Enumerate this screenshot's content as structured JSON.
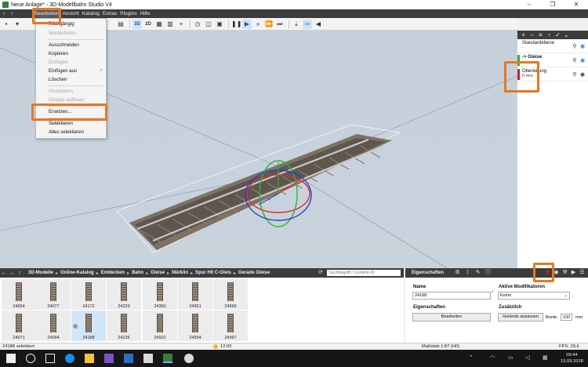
{
  "window": {
    "title": "Neue Anlage* - 3D-Modellbahn Studio V4",
    "title_visible": "Neue Anlage* - 3D-Modellbahn Studio V4"
  },
  "menubar": {
    "items": [
      "Bearbeiten",
      "Ansicht",
      "Katalog",
      "Extras",
      "Plugins",
      "Hilfe"
    ],
    "active": "Bearbeiten"
  },
  "toolbar": {
    "btn_3d": "3D",
    "btn_2d": "2D"
  },
  "dropdown": {
    "items": [
      {
        "label": "Rückgängig",
        "enabled": true
      },
      {
        "label": "Wiederholen",
        "enabled": false
      },
      {
        "label": "Ausschneiden",
        "enabled": true
      },
      {
        "label": "Kopieren",
        "enabled": true
      },
      {
        "label": "Einfügen",
        "enabled": false
      },
      {
        "label": "Einfügen aus",
        "enabled": true,
        "submenu": true
      },
      {
        "label": "Löschen",
        "enabled": true
      },
      {
        "label": "Gruppieren",
        "enabled": false
      },
      {
        "label": "Gruppe auflösen",
        "enabled": false
      },
      {
        "label": "Ersetzen...",
        "enabled": true
      },
      {
        "label": "Selektieren",
        "enabled": true
      },
      {
        "label": "Alles selektieren",
        "enabled": true
      }
    ]
  },
  "layers": [
    {
      "name": "Standardebene",
      "sub": "-",
      "color": "#ffffff"
    },
    {
      "name": "-> Gleise",
      "sub": "-",
      "color": "#2bb52b"
    },
    {
      "name": "Oberleitung",
      "sub": "0 mm",
      "color": "#d21f1f"
    }
  ],
  "catalog": {
    "breadcrumb": [
      "3D-Modelle",
      "Online-Katalog",
      "Entdecken",
      "Bahn",
      "Gleise",
      "Märklin",
      "Spur H0 C-Gleis",
      "Gerade Gleise"
    ],
    "search_placeholder": "Suchbegriff / Content-ID",
    "tiles": [
      "24064",
      "24077",
      "24172",
      "24229",
      "24360",
      "24951",
      "24995",
      "24071",
      "24094",
      "24188",
      "24236",
      "24922",
      "24994",
      "24997"
    ],
    "selected": "24188"
  },
  "properties": {
    "title": "Eigenschaften",
    "name_label": "Name",
    "name_value": "24188",
    "modifier_label": "Aktive Modifikatoren",
    "modifier_value": "Keine",
    "section_props": "Eigenschaften",
    "edit_button": "Bearbeiten",
    "section_extra": "Zusätzlich",
    "terrain_button": "Gelände anpassen",
    "width_label": "Breite:",
    "width_value": "100",
    "width_unit": "mm"
  },
  "status": {
    "selection": "24188 selektiert",
    "time": "12:00",
    "scale": "Maßstab 1:87 (H0)",
    "fps": "FPS: 29,6"
  },
  "taskbar": {
    "time": "09:44",
    "date": "15.09.2018"
  }
}
